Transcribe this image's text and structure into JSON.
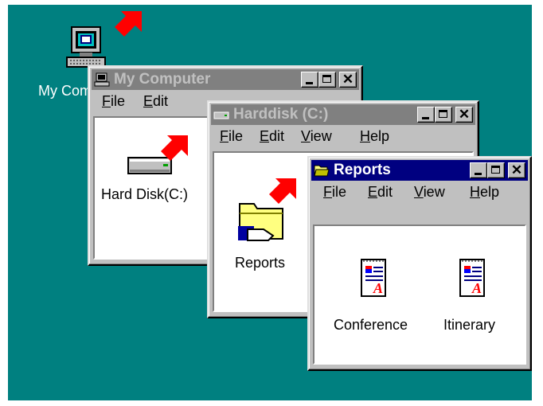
{
  "desktop": {
    "bg_color": "#008080",
    "my_computer_label": "My Computer"
  },
  "win1": {
    "title": "My Computer",
    "icon": "computer-icon",
    "menus": [
      "File",
      "Edit"
    ],
    "items": [
      {
        "label": "Hard Disk(C:)",
        "icon": "hard-disk-icon"
      }
    ]
  },
  "win2": {
    "title": "Harddisk (C:)",
    "icon": "drive-icon",
    "menus": [
      "File",
      "Edit",
      "View",
      "Help"
    ],
    "items": [
      {
        "label": "Reports",
        "icon": "folder-icon"
      }
    ]
  },
  "win3": {
    "title": "Reports",
    "icon": "open-folder-icon",
    "menus": [
      "File",
      "Edit",
      "View",
      "Help"
    ],
    "items": [
      {
        "label": "Conference",
        "icon": "document-icon"
      },
      {
        "label": "Itinerary",
        "icon": "document-icon"
      }
    ]
  },
  "colors": {
    "arrow": "#ff0000",
    "active_title": "#000080",
    "inactive_title": "#808080"
  }
}
